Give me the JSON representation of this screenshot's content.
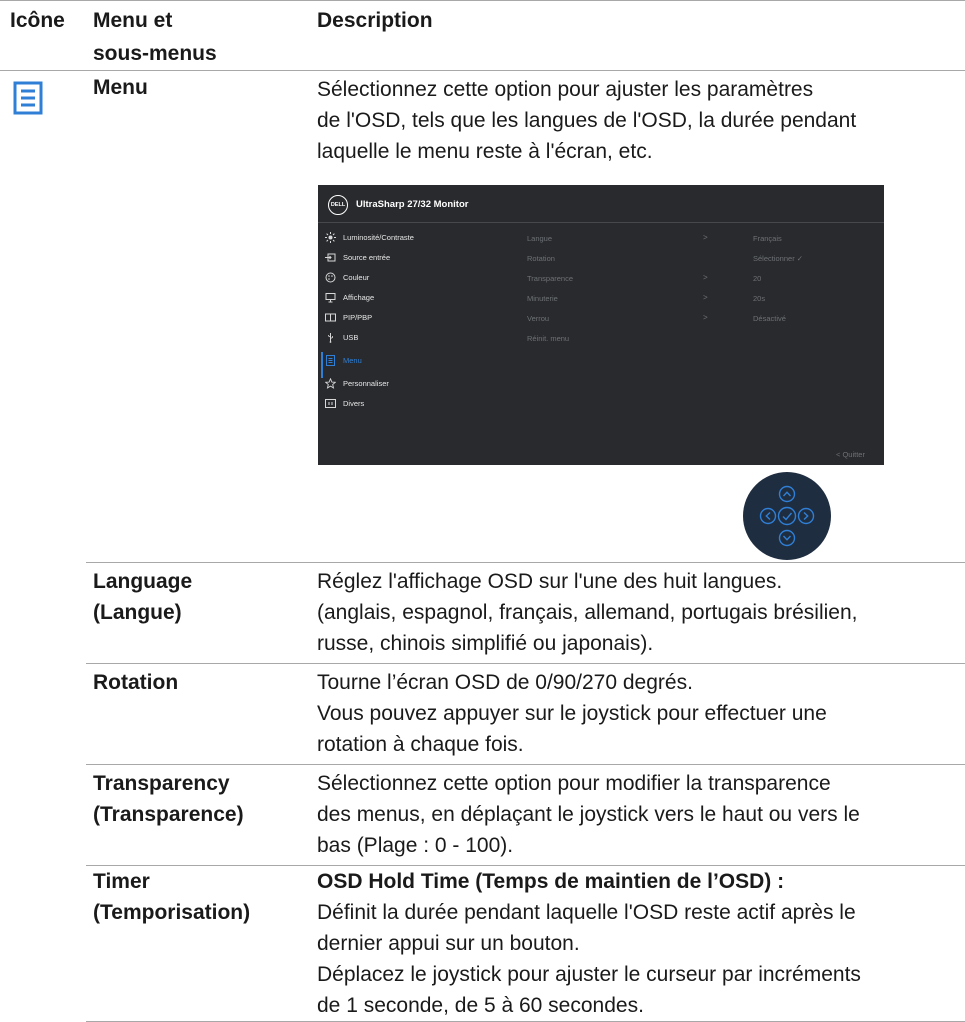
{
  "table": {
    "headers": {
      "icon": "Icône",
      "menu": [
        "Menu et",
        "sous-menus"
      ],
      "description": "Description"
    },
    "rows": [
      {
        "label": [
          "Menu"
        ],
        "icon": "menu-icon",
        "description": [
          "Sélectionnez cette option pour ajuster les paramètres",
          "de l'OSD, tels que les langues de l'OSD, la durée pendant",
          "laquelle le menu reste à l'écran, etc."
        ]
      },
      {
        "label": [
          "Language",
          "(Langue)"
        ],
        "description": [
          "Réglez l'affichage OSD sur l'une des huit langues.",
          "(anglais, espagnol, français, allemand, portugais brésilien,",
          "russe, chinois simplifié ou japonais)."
        ]
      },
      {
        "label": [
          "Rotation"
        ],
        "description": [
          "Tourne l’écran OSD de 0/90/270 degrés.",
          "Vous pouvez appuyer sur le joystick pour effectuer une",
          "rotation à chaque fois."
        ]
      },
      {
        "label": [
          "Transparency",
          "(Transparence)"
        ],
        "description": [
          "Sélectionnez cette option pour modifier la transparence",
          "des menus, en déplaçant le joystick vers le haut ou vers le",
          "bas (Plage : 0 - 100)."
        ]
      },
      {
        "label": [
          "Timer",
          "(Temporisation)"
        ],
        "description_title": "OSD Hold Time (Temps de maintien de l’OSD) :",
        "description": [
          "Définit la durée pendant laquelle l'OSD reste actif après le",
          "dernier appui sur un bouton.",
          "Déplacez le joystick pour ajuster le curseur par incréments",
          "de 1 seconde, de 5 à 60 secondes."
        ]
      }
    ]
  },
  "osd": {
    "logo": "DELL",
    "title": "UltraSharp 27/32 Monitor",
    "menu_items": [
      {
        "label": "Luminosité/Contraste",
        "icon": "brightness-icon",
        "selected": false
      },
      {
        "label": "Source entrée",
        "icon": "input-source-icon",
        "selected": false
      },
      {
        "label": "Couleur",
        "icon": "color-icon",
        "selected": false
      },
      {
        "label": "Affichage",
        "icon": "display-icon",
        "selected": false
      },
      {
        "label": "PIP/PBP",
        "icon": "pip-icon",
        "selected": false
      },
      {
        "label": "USB",
        "icon": "usb-icon",
        "selected": false
      },
      {
        "label": "Menu",
        "icon": "menu-icon",
        "selected": true
      },
      {
        "label": "Personnaliser",
        "icon": "star-icon",
        "selected": false
      },
      {
        "label": "Divers",
        "icon": "others-icon",
        "selected": false
      }
    ],
    "submenu": [
      {
        "label": "Langue",
        "arrow": ">",
        "value": "Français"
      },
      {
        "label": "Rotation",
        "arrow": "",
        "value": "Sélectionner ✓"
      },
      {
        "label": "Transparence",
        "arrow": ">",
        "value": "20"
      },
      {
        "label": "Minuterie",
        "arrow": ">",
        "value": "20s"
      },
      {
        "label": "Verrou",
        "arrow": ">",
        "value": "Désactivé"
      },
      {
        "label": "Réinit. menu",
        "arrow": "",
        "value": ""
      }
    ],
    "quit": "<  Quitter"
  },
  "colors": {
    "accent": "#2f7fd6",
    "osd_background": "#282a2d",
    "joystick_background": "#1f2d40",
    "divider": "#a8a8a8"
  }
}
